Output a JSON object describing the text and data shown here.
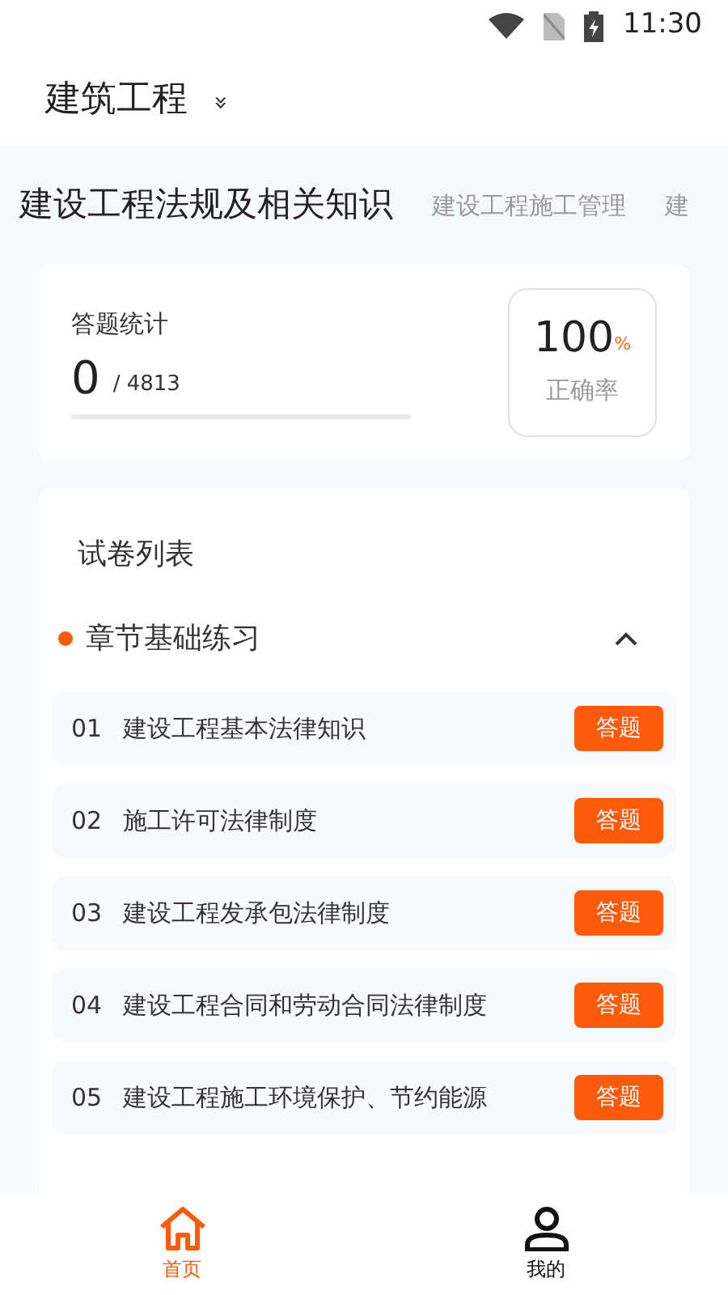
{
  "status_bar": {
    "time": "11:30"
  },
  "header": {
    "title": "建筑工程",
    "toggle": "»"
  },
  "tabs": [
    {
      "label": "建设工程法规及相关知识",
      "selected": true
    },
    {
      "label": "建设工程施工管理",
      "selected": false
    },
    {
      "label": "建",
      "selected": false
    }
  ],
  "stats": {
    "title": "答题统计",
    "done": "0",
    "total": "/ 4813",
    "level": 0,
    "accuracy": "100",
    "accuracy_unit": "%",
    "accuracy_label": "正确率"
  },
  "paper_list": {
    "title": "试卷列表",
    "section": {
      "title": "章节基础练习",
      "expanded": true
    },
    "items": [
      {
        "number": "01",
        "title": "建设工程基本法律知识",
        "action": "答题"
      },
      {
        "number": "02",
        "title": "施工许可法律制度",
        "action": "答题"
      },
      {
        "number": "03",
        "title": "建设工程发承包法律制度",
        "action": "答题"
      },
      {
        "number": "04",
        "title": "建设工程合同和劳动合同法律制度",
        "action": "答题"
      },
      {
        "number": "05",
        "title": "建设工程施工环境保护、节约能源",
        "action": "答题"
      }
    ]
  },
  "bottom_nav": [
    {
      "label": "首页",
      "kind": "home",
      "selected": true
    },
    {
      "label": "我的",
      "kind": "profile",
      "selected": false
    }
  ]
}
